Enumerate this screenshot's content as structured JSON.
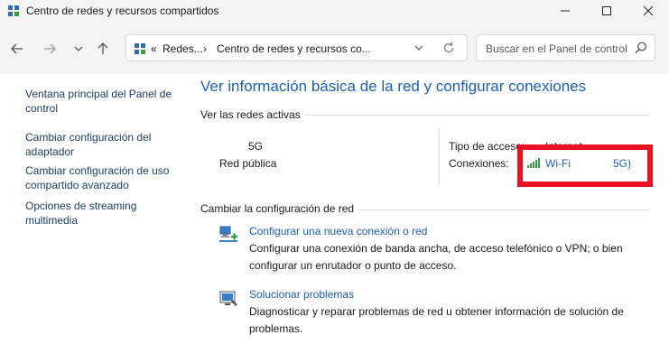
{
  "window": {
    "title": "Centro de redes y recursos compartidos"
  },
  "nav": {
    "breadcrumb_overflow": "«",
    "breadcrumb_1": "Redes...",
    "breadcrumb_sep": "›",
    "breadcrumb_2": "Centro de redes y recursos co...",
    "search_placeholder": "Buscar en el Panel de control"
  },
  "sidebar": {
    "items": [
      {
        "label": "Ventana principal del Panel de control"
      },
      {
        "label": "Cambiar configuración del adaptador"
      },
      {
        "label": "Cambiar configuración de uso compartido avanzado"
      },
      {
        "label": "Opciones de streaming multimedia"
      }
    ]
  },
  "main": {
    "title": "Ver información básica de la red y configurar conexiones",
    "active_networks_heading": "Ver las redes activas",
    "network": {
      "name": "5G",
      "type": "Red pública",
      "access_type_label": "Tipo de acceso:",
      "access_type_value": "Internet",
      "connections_label": "Conexiones:",
      "connection_name": "Wi-Fi",
      "connection_suffix": "5G)"
    },
    "change_heading": "Cambiar la configuración de red",
    "tasks": [
      {
        "title": "Configurar una nueva conexión o red",
        "desc": "Configurar una conexión de banda ancha, de acceso telefónico o VPN; o bien configurar un enrutador o punto de acceso."
      },
      {
        "title": "Solucionar problemas",
        "desc": "Diagnosticar y reparar problemas de red u obtener información de solución de problemas."
      }
    ]
  },
  "colors": {
    "link": "#1a5fb4",
    "highlight_border": "#e81123",
    "sidebar_link": "#1a3e66"
  }
}
